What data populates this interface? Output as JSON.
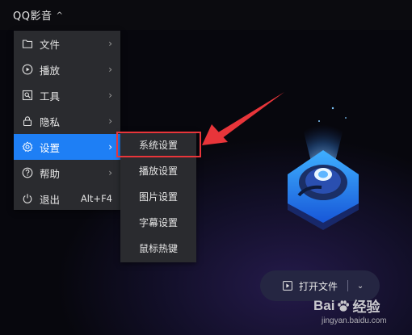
{
  "titlebar": {
    "app_name": "QQ影音",
    "caret_icon": "^"
  },
  "menu": {
    "items": [
      {
        "icon": "folder-icon",
        "label": "文件",
        "arrow": "›"
      },
      {
        "icon": "play-circle-icon",
        "label": "播放",
        "arrow": "›"
      },
      {
        "icon": "tools-icon",
        "label": "工具",
        "arrow": "›"
      },
      {
        "icon": "lock-icon",
        "label": "隐私",
        "arrow": "›"
      },
      {
        "icon": "gear-icon",
        "label": "设置",
        "arrow": "›",
        "active": true
      },
      {
        "icon": "help-icon",
        "label": "帮助",
        "arrow": "›"
      },
      {
        "icon": "power-icon",
        "label": "退出",
        "shortcut": "Alt+F4"
      }
    ]
  },
  "submenu": {
    "items": [
      "系统设置",
      "播放设置",
      "图片设置",
      "字幕设置",
      "鼠标热键"
    ]
  },
  "open_button": {
    "label": "打开文件",
    "dropdown_icon": "⌄"
  },
  "watermark": {
    "brand_prefix": "Bai",
    "brand_suffix": "经验",
    "url": "jingyan.baidu.com"
  },
  "colors": {
    "accent": "#1e7ff5",
    "highlight": "#e8353a",
    "menu_bg": "#2a2b2f"
  }
}
